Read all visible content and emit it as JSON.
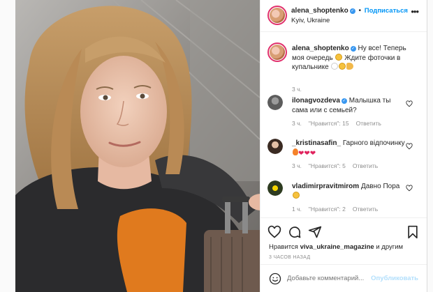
{
  "header": {
    "username": "alena_shoptenko",
    "verified_mark": "✓",
    "separator": "•",
    "follow_label": "Подписаться",
    "location": "Kyiv, Ukraine",
    "more_icon": "more-horizontal-icon",
    "more_glyph": "•••"
  },
  "caption": {
    "username": "alena_shoptenko",
    "text_1": "Ну все! Теперь моя очередь",
    "text_2": "Ждите фоточки в купальнике",
    "time": "3 ч."
  },
  "comments": [
    {
      "username": "ilonagvozdeva",
      "verified": true,
      "text": "Малышка ты сама или с семьей?",
      "time": "3 ч.",
      "likes": "\"Нравится\": 15",
      "reply": "Ответить"
    },
    {
      "username": "_kristinasafin_",
      "verified": false,
      "text": "Гарного відпочинку",
      "time": "3 ч.",
      "likes": "\"Нравится\": 5",
      "reply": "Ответить"
    },
    {
      "username": "vladimirpravitmirom",
      "verified": false,
      "text": "Давно Пора",
      "time": "1 ч.",
      "likes": "\"Нравится\": 2",
      "reply": "Ответить"
    }
  ],
  "actions": {
    "likes_prefix": "Нравится",
    "likes_user": "viva_ukraine_magazine",
    "likes_suffix": "и другим",
    "posted_ago": "3 часов назад"
  },
  "add_comment": {
    "placeholder": "Добавьте комментарий...",
    "post_label": "Опубликовать"
  },
  "colors": {
    "accent_blue": "#0095f6",
    "verified_blue": "#3897f0",
    "muted_gray": "#8e8e8e",
    "post_disabled": "#b2dffc",
    "heart_red": "#e0245e"
  }
}
